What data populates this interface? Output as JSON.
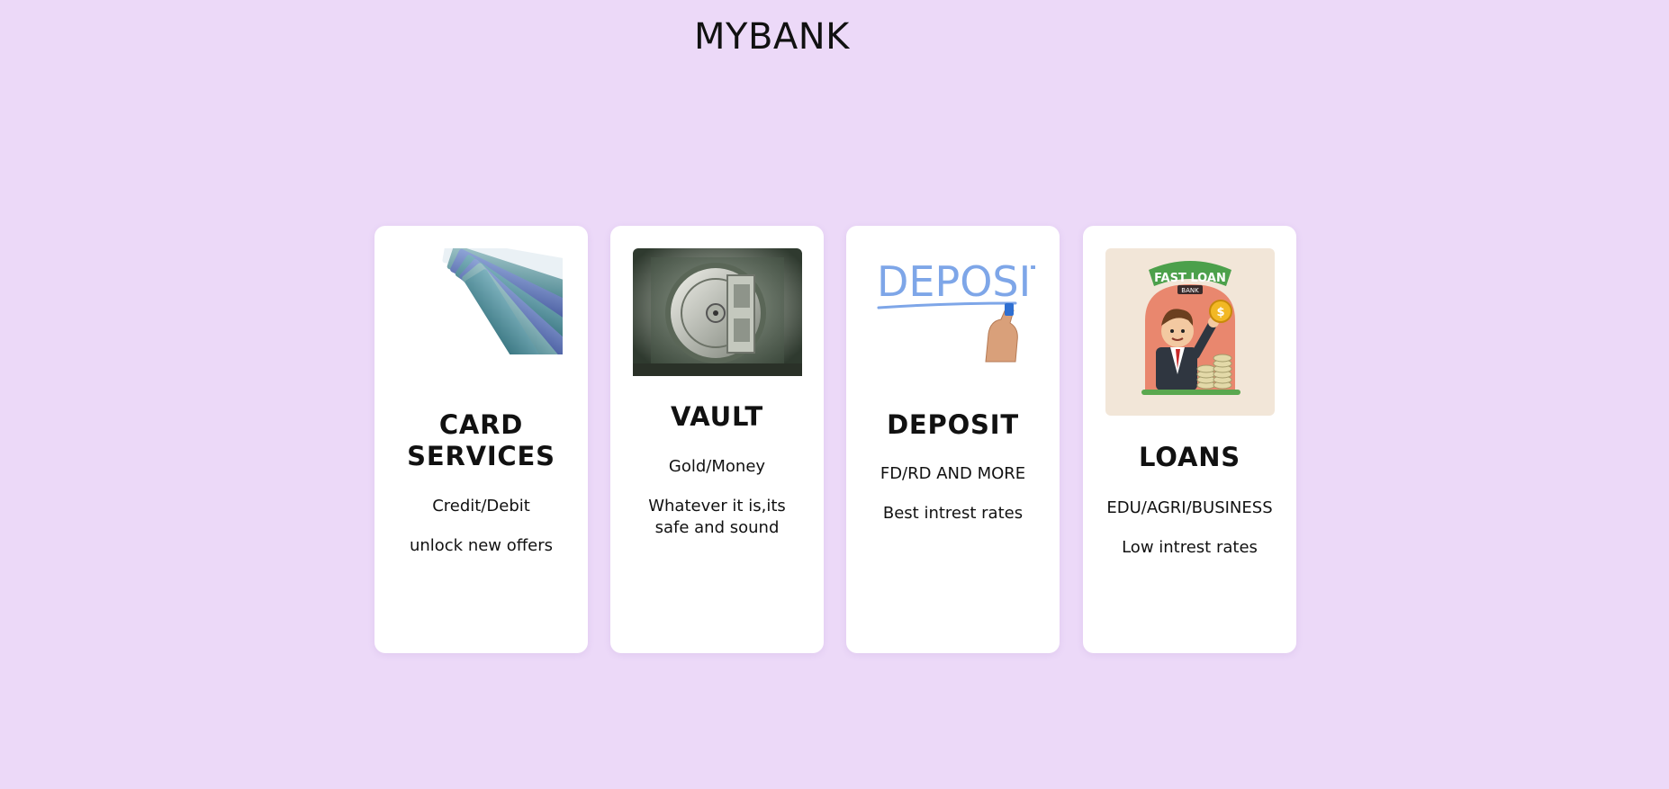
{
  "header": {
    "title": "MYBANK"
  },
  "cards": [
    {
      "title": "CARD SERVICES",
      "lines": [
        "Credit/Debit",
        "unlock new offers"
      ],
      "image": "credit-cards-image"
    },
    {
      "title": "VAULT",
      "lines": [
        "Gold/Money",
        "Whatever it is,its safe and sound"
      ],
      "image": "vault-door-image"
    },
    {
      "title": "DEPOSIT",
      "lines": [
        "FD/RD AND MORE",
        "Best intrest rates"
      ],
      "image": "deposit-writing-image",
      "image_text": "DEPOSIT"
    },
    {
      "title": "LOANS",
      "lines": [
        "EDU/AGRI/BUSINESS",
        "Low intrest rates"
      ],
      "image": "fast-loan-image",
      "image_text": "FAST LOAN",
      "image_subtext": "BANK"
    }
  ],
  "colors": {
    "page_background": "#ecd9f8",
    "card_background": "#ffffff",
    "text": "#111111",
    "accent_blue": "#7ea6e8"
  }
}
